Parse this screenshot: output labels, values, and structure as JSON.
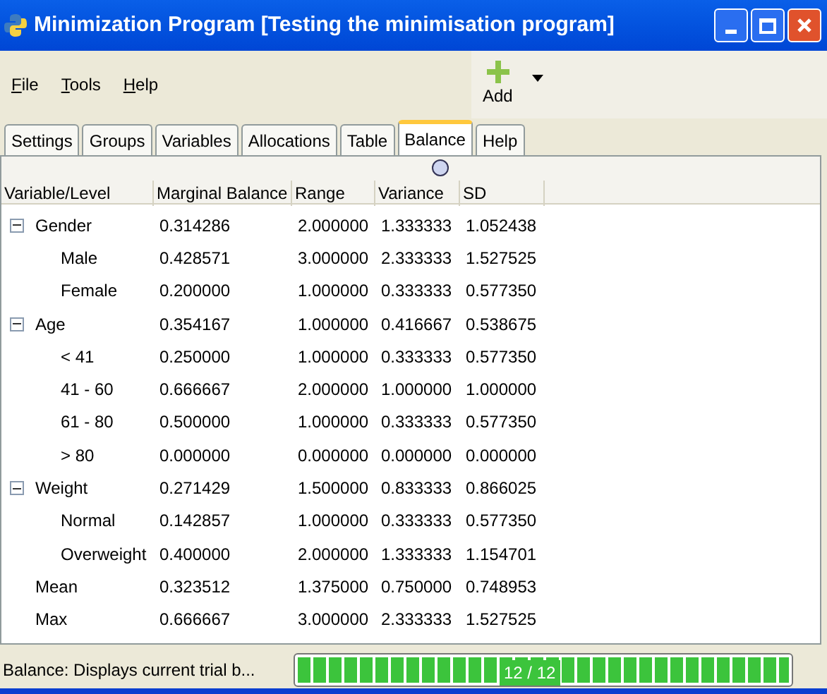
{
  "window": {
    "title": "Minimization Program [Testing the minimisation program]"
  },
  "menu": [
    {
      "label": "File"
    },
    {
      "label": "Tools"
    },
    {
      "label": "Help"
    }
  ],
  "toolbar": {
    "add_button": "Add"
  },
  "tabs": [
    {
      "label": "Settings",
      "selected": false
    },
    {
      "label": "Groups",
      "selected": false
    },
    {
      "label": "Variables",
      "selected": false
    },
    {
      "label": "Allocations",
      "selected": false
    },
    {
      "label": "Table",
      "selected": false
    },
    {
      "label": "Balance",
      "selected": true
    },
    {
      "label": "Help",
      "selected": false
    }
  ],
  "table": {
    "columns": [
      "Variable/Level",
      "Marginal Balance",
      "Range",
      "Variance",
      "SD"
    ],
    "rows": [
      {
        "kind": "group",
        "expanded": true,
        "cells": [
          "Gender",
          "0.314286",
          "2.000000",
          "1.333333",
          "1.052438"
        ],
        "children": [
          {
            "cells": [
              "Male",
              "0.428571",
              "3.000000",
              "2.333333",
              "1.527525"
            ]
          },
          {
            "cells": [
              "Female",
              "0.200000",
              "1.000000",
              "0.333333",
              "0.577350"
            ]
          }
        ]
      },
      {
        "kind": "group",
        "expanded": true,
        "cells": [
          "Age",
          "0.354167",
          "1.000000",
          "0.416667",
          "0.538675"
        ],
        "children": [
          {
            "cells": [
              "< 41",
              "0.250000",
              "1.000000",
              "0.333333",
              "0.577350"
            ]
          },
          {
            "cells": [
              "41 - 60",
              "0.666667",
              "2.000000",
              "1.000000",
              "1.000000"
            ]
          },
          {
            "cells": [
              "61 - 80",
              "0.500000",
              "1.000000",
              "0.333333",
              "0.577350"
            ]
          },
          {
            "cells": [
              "> 80",
              "0.000000",
              "0.000000",
              "0.000000",
              "0.000000"
            ]
          }
        ]
      },
      {
        "kind": "group",
        "expanded": true,
        "cells": [
          "Weight",
          "0.271429",
          "1.500000",
          "0.833333",
          "0.866025"
        ],
        "children": [
          {
            "cells": [
              "Normal",
              "0.142857",
              "1.000000",
              "0.333333",
              "0.577350"
            ]
          },
          {
            "cells": [
              "Overweight",
              "0.400000",
              "2.000000",
              "1.333333",
              "1.154701"
            ]
          }
        ]
      },
      {
        "kind": "summary",
        "cells": [
          "Mean",
          "0.323512",
          "1.375000",
          "0.750000",
          "0.748953"
        ]
      },
      {
        "kind": "summary",
        "cells": [
          "Max",
          "0.666667",
          "3.000000",
          "2.333333",
          "1.527525"
        ]
      }
    ]
  },
  "status_bar": {
    "message": "Balance: Displays current trial b...",
    "progress": {
      "level": 1,
      "reading": "12 / 12"
    }
  }
}
